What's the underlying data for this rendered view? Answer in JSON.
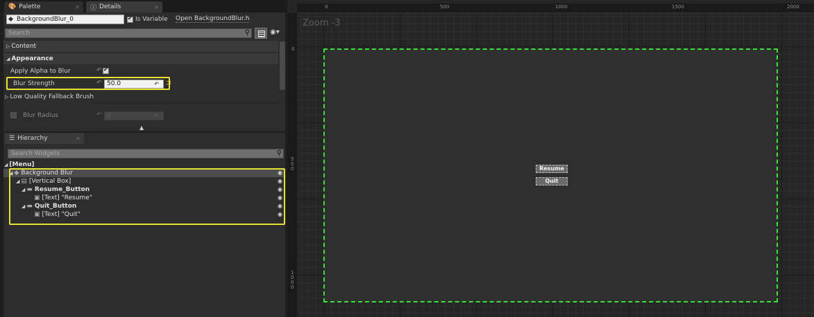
{
  "tabs": {
    "palette": "Palette",
    "details": "Details",
    "hierarchy": "Hierarchy"
  },
  "details": {
    "widget_name": "BackgroundBlur_0",
    "is_variable_label": "Is Variable",
    "is_variable_checked": true,
    "open_link": "Open BackgroundBlur.h",
    "search_placeholder": "Search",
    "categories": {
      "content": "Content",
      "appearance": "Appearance"
    },
    "properties": {
      "apply_alpha_label": "Apply Alpha to Blur",
      "apply_alpha_checked": true,
      "blur_strength_label": "Blur Strength",
      "blur_strength_value": "50.0",
      "low_quality_label": "Low Quality Fallback Brush",
      "blur_radius_label": "Blur Radius",
      "blur_radius_value": "0"
    }
  },
  "hierarchy": {
    "search_placeholder": "Search Widgets",
    "root": "[Menu]",
    "items": [
      {
        "label": "Background Blur"
      },
      {
        "label": "[Vertical Box]"
      },
      {
        "label": "Resume_Button"
      },
      {
        "label": "[Text] \"Resume\""
      },
      {
        "label": "Quit_Button"
      },
      {
        "label": "[Text] \"Quit\""
      }
    ]
  },
  "designer": {
    "zoom": "Zoom -3",
    "ruler_h": [
      "0",
      "500",
      "1000",
      "1500",
      "2000"
    ],
    "ruler_v": [
      "0",
      "500",
      "1000"
    ],
    "buttons": {
      "resume": "Resume",
      "quit": "Quit"
    }
  },
  "colors": {
    "highlight": "#e8e234",
    "frame_border": "#3ce23c",
    "panel_bg": "#2d2d2d"
  }
}
